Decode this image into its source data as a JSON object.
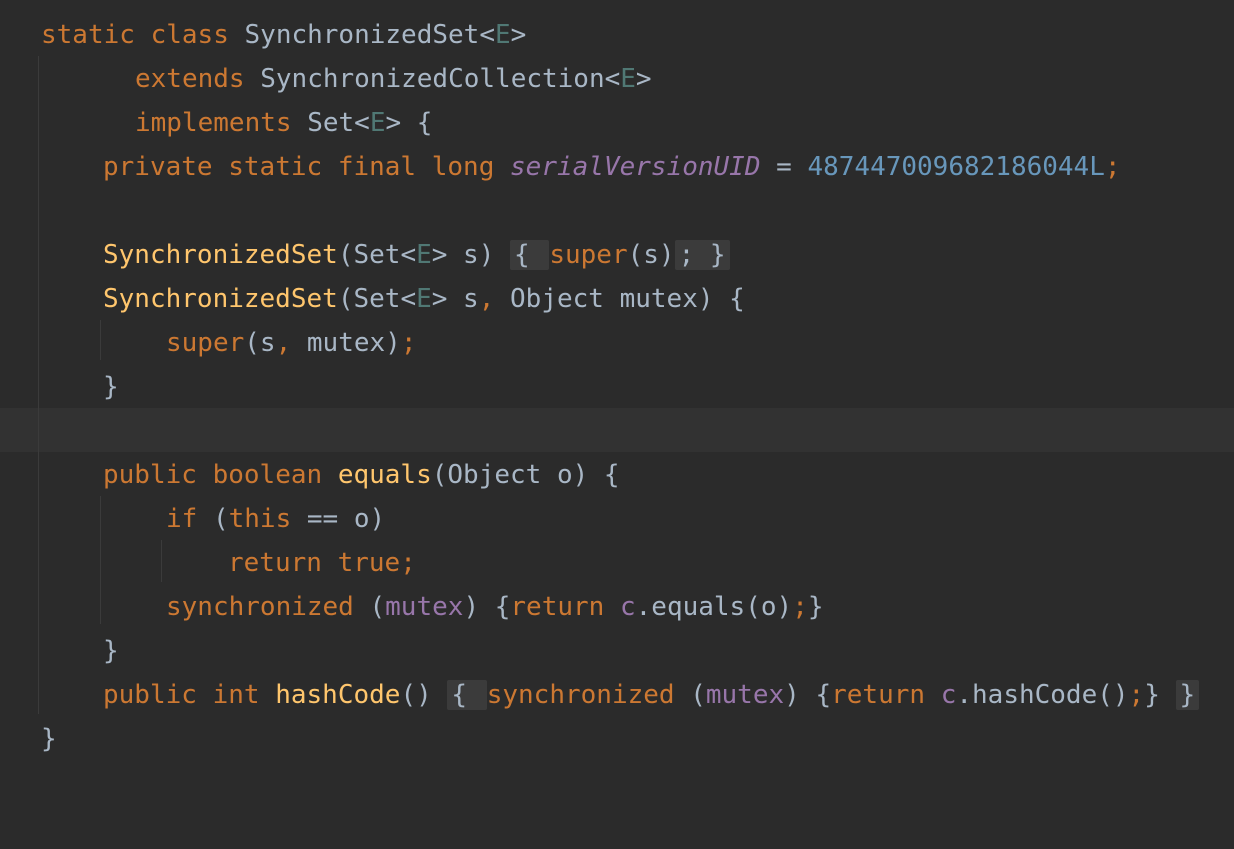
{
  "editor": {
    "lines": [
      {
        "tokens": [
          {
            "t": "static",
            "c": "kw"
          },
          {
            "t": " ",
            "c": "plain"
          },
          {
            "t": "class",
            "c": "kw"
          },
          {
            "t": " ",
            "c": "plain"
          },
          {
            "t": "SynchronizedSet",
            "c": "cls"
          },
          {
            "t": "<",
            "c": "op"
          },
          {
            "t": "E",
            "c": "tp"
          },
          {
            "t": ">",
            "c": "op"
          }
        ]
      },
      {
        "tokens": [
          {
            "t": "extends",
            "c": "kw"
          },
          {
            "t": " ",
            "c": "plain"
          },
          {
            "t": "SynchronizedCollection",
            "c": "cls"
          },
          {
            "t": "<",
            "c": "op"
          },
          {
            "t": "E",
            "c": "tp"
          },
          {
            "t": ">",
            "c": "op"
          }
        ]
      },
      {
        "tokens": [
          {
            "t": "implements",
            "c": "kw"
          },
          {
            "t": " ",
            "c": "plain"
          },
          {
            "t": "Set",
            "c": "cls"
          },
          {
            "t": "<",
            "c": "op"
          },
          {
            "t": "E",
            "c": "tp"
          },
          {
            "t": "> {",
            "c": "op"
          }
        ]
      },
      {
        "tokens": [
          {
            "t": "private",
            "c": "kw"
          },
          {
            "t": " ",
            "c": "plain"
          },
          {
            "t": "static",
            "c": "kw"
          },
          {
            "t": " ",
            "c": "plain"
          },
          {
            "t": "final",
            "c": "kw"
          },
          {
            "t": " ",
            "c": "plain"
          },
          {
            "t": "long",
            "c": "kw"
          },
          {
            "t": " ",
            "c": "plain"
          },
          {
            "t": "serialVersionUID",
            "c": "fld-it"
          },
          {
            "t": " = ",
            "c": "op"
          },
          {
            "t": "487447009682186044L",
            "c": "num"
          },
          {
            "t": ";",
            "c": "punc"
          }
        ]
      },
      {
        "tokens": []
      },
      {
        "tokens": [
          {
            "t": "SynchronizedSet",
            "c": "fn"
          },
          {
            "t": "(",
            "c": "op"
          },
          {
            "t": "Set",
            "c": "cls"
          },
          {
            "t": "<",
            "c": "op"
          },
          {
            "t": "E",
            "c": "tp"
          },
          {
            "t": "> s) ",
            "c": "op"
          },
          {
            "t": "{ ",
            "c": "fold"
          },
          {
            "t": "super",
            "c": "kw"
          },
          {
            "t": "(s)",
            "c": "op"
          },
          {
            "t": "; }",
            "c": "fold"
          }
        ]
      },
      {
        "tokens": [
          {
            "t": "SynchronizedSet",
            "c": "fn"
          },
          {
            "t": "(",
            "c": "op"
          },
          {
            "t": "Set",
            "c": "cls"
          },
          {
            "t": "<",
            "c": "op"
          },
          {
            "t": "E",
            "c": "tp"
          },
          {
            "t": "> s",
            "c": "op"
          },
          {
            "t": ",",
            "c": "punc"
          },
          {
            "t": " Object mutex) {",
            "c": "op"
          }
        ]
      },
      {
        "tokens": [
          {
            "t": "super",
            "c": "kw"
          },
          {
            "t": "(s",
            "c": "op"
          },
          {
            "t": ",",
            "c": "punc"
          },
          {
            "t": " mutex)",
            "c": "op"
          },
          {
            "t": ";",
            "c": "punc"
          }
        ]
      },
      {
        "tokens": [
          {
            "t": "}",
            "c": "op"
          }
        ]
      },
      {
        "tokens": []
      },
      {
        "tokens": [
          {
            "t": "public",
            "c": "kw"
          },
          {
            "t": " ",
            "c": "plain"
          },
          {
            "t": "boolean",
            "c": "kw"
          },
          {
            "t": " ",
            "c": "plain"
          },
          {
            "t": "equals",
            "c": "fn"
          },
          {
            "t": "(Object o) {",
            "c": "op"
          }
        ]
      },
      {
        "tokens": [
          {
            "t": "if",
            "c": "kw"
          },
          {
            "t": " (",
            "c": "op"
          },
          {
            "t": "this",
            "c": "kw"
          },
          {
            "t": " == o)",
            "c": "op"
          }
        ]
      },
      {
        "tokens": [
          {
            "t": "return",
            "c": "kw"
          },
          {
            "t": " ",
            "c": "plain"
          },
          {
            "t": "true",
            "c": "kw"
          },
          {
            "t": ";",
            "c": "punc"
          }
        ]
      },
      {
        "tokens": [
          {
            "t": "synchronized",
            "c": "kw"
          },
          {
            "t": " (",
            "c": "op"
          },
          {
            "t": "mutex",
            "c": "fld"
          },
          {
            "t": ") {",
            "c": "op"
          },
          {
            "t": "return",
            "c": "kw"
          },
          {
            "t": " ",
            "c": "plain"
          },
          {
            "t": "c",
            "c": "fld"
          },
          {
            "t": ".equals(o)",
            "c": "op"
          },
          {
            "t": ";",
            "c": "punc"
          },
          {
            "t": "}",
            "c": "op"
          }
        ]
      },
      {
        "tokens": [
          {
            "t": "}",
            "c": "op"
          }
        ]
      },
      {
        "tokens": [
          {
            "t": "public",
            "c": "kw"
          },
          {
            "t": " ",
            "c": "plain"
          },
          {
            "t": "int",
            "c": "kw"
          },
          {
            "t": " ",
            "c": "plain"
          },
          {
            "t": "hashCode",
            "c": "fn"
          },
          {
            "t": "()",
            "c": "op"
          },
          {
            "t": " ",
            "c": "plain"
          },
          {
            "t": "{ ",
            "c": "fold"
          },
          {
            "t": "synchronized",
            "c": "kw"
          },
          {
            "t": " (",
            "c": "op"
          },
          {
            "t": "mutex",
            "c": "fld"
          },
          {
            "t": ") {",
            "c": "op"
          },
          {
            "t": "return",
            "c": "kw"
          },
          {
            "t": " ",
            "c": "plain"
          },
          {
            "t": "c",
            "c": "fld"
          },
          {
            "t": ".hashCode()",
            "c": "op"
          },
          {
            "t": ";",
            "c": "punc"
          },
          {
            "t": "}",
            "c": "op"
          },
          {
            "t": " ",
            "c": "plain"
          },
          {
            "t": "}",
            "c": "fold"
          }
        ]
      },
      {
        "tokens": [
          {
            "t": "}",
            "c": "op"
          }
        ]
      }
    ]
  },
  "colors": {
    "background": "#2b2b2b",
    "current_line": "#323232",
    "keyword": "#cc7832",
    "function": "#ffc66d",
    "field": "#9876aa",
    "number": "#6897bb",
    "type_param": "#507874",
    "text": "#a9b7c6"
  }
}
